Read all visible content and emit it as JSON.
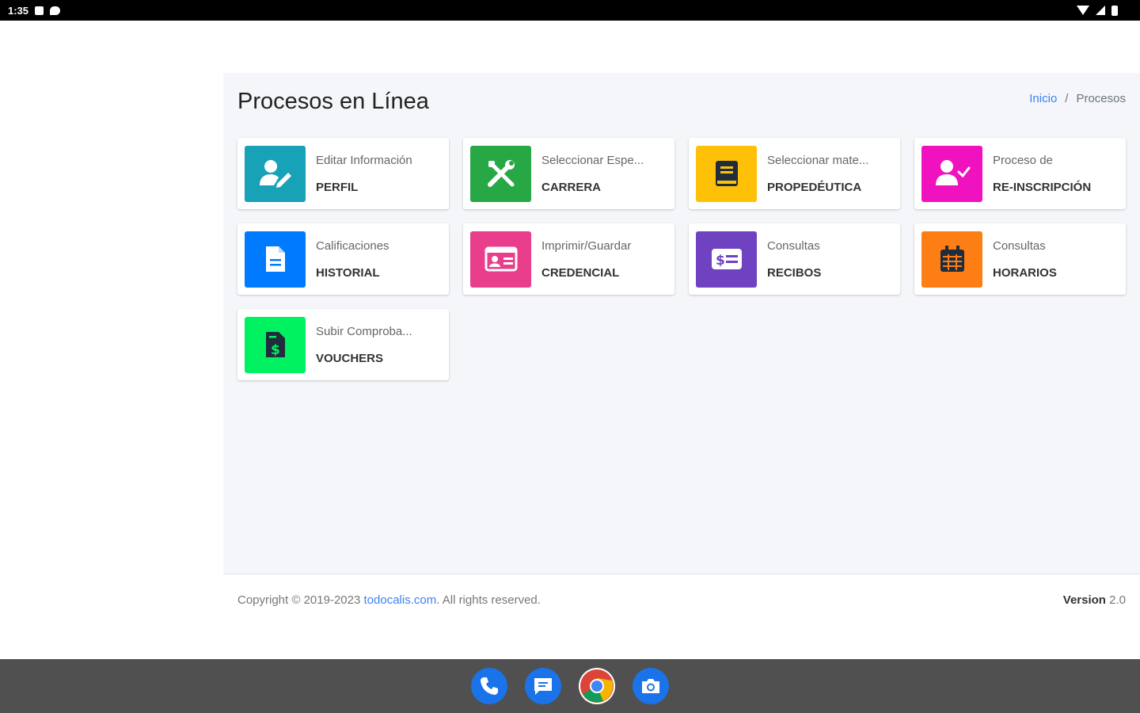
{
  "status_bar": {
    "time": "1:35"
  },
  "page": {
    "title": "Procesos en Línea"
  },
  "breadcrumb": {
    "home": "Inicio",
    "separator": "/",
    "current": "Procesos"
  },
  "cards": [
    {
      "subtitle": "Editar Información",
      "title": "PERFIL",
      "color": "#17a2b8",
      "icon": "user-edit-icon"
    },
    {
      "subtitle": "Seleccionar Espe...",
      "title": "CARRERA",
      "color": "#28a745",
      "icon": "tools-icon"
    },
    {
      "subtitle": "Seleccionar mate...",
      "title": "PROPEDÉUTICA",
      "color": "#ffc107",
      "icon": "book-icon"
    },
    {
      "subtitle": "Proceso de",
      "title": "RE-INSCRIPCIÓN",
      "color": "#f012be",
      "icon": "user-check-icon"
    },
    {
      "subtitle": "Calificaciones",
      "title": "HISTORIAL",
      "color": "#007bff",
      "icon": "file-icon"
    },
    {
      "subtitle": "Imprimir/Guardar",
      "title": "CREDENCIAL",
      "color": "#e83e8c",
      "icon": "id-card-icon"
    },
    {
      "subtitle": "Consultas",
      "title": "RECIBOS",
      "color": "#6f42c1",
      "icon": "money-bill-icon"
    },
    {
      "subtitle": "Consultas",
      "title": "HORARIOS",
      "color": "#fd7e14",
      "icon": "calendar-icon"
    },
    {
      "subtitle": "Subir Comproba...",
      "title": "VOUCHERS",
      "color": "#00f260",
      "icon": "file-invoice-dollar-icon"
    }
  ],
  "footer": {
    "copyright_prefix": "Copyright © 2019-2023",
    "link_text": "todocalis.com",
    "copyright_suffix": ". All rights reserved.",
    "version_label": "Version",
    "version_value": "2.0"
  },
  "dock": {
    "apps": [
      "phone-icon",
      "messages-icon",
      "chrome-icon",
      "camera-icon"
    ]
  }
}
